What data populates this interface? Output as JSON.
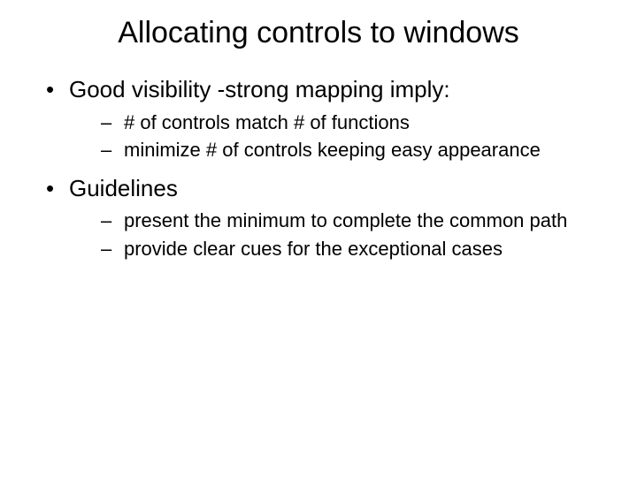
{
  "title": "Allocating controls to windows",
  "bullets": [
    {
      "text": "Good visibility -strong mapping imply:",
      "sub": [
        "# of controls match # of functions",
        "minimize # of controls keeping easy appearance"
      ]
    },
    {
      "text": "Guidelines",
      "sub": [
        "present the minimum to complete the common path",
        "provide clear cues for the exceptional cases"
      ]
    }
  ]
}
